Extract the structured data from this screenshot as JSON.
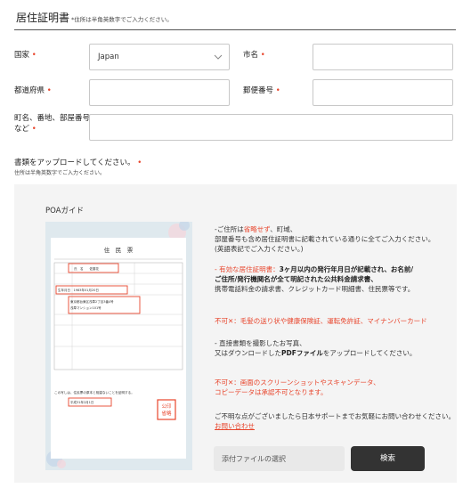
{
  "header": {
    "title": "居住証明書",
    "subtitle": "*住所は半角英数字でご入力ください。"
  },
  "form": {
    "country": {
      "label": "国家",
      "value": "Japan"
    },
    "city": {
      "label": "市名",
      "value": ""
    },
    "prefecture": {
      "label": "都道府県",
      "value": ""
    },
    "postal": {
      "label": "郵便番号",
      "value": ""
    },
    "address_line1": "町名、番地、部屋番号",
    "address_line2": "など",
    "address_value": "",
    "required_mark": "•"
  },
  "upload": {
    "label": "書類をアップロードしてください。",
    "note": "住所は半角英数字でご入力ください。"
  },
  "guide": {
    "title": "POAガイド",
    "sample": {
      "heading": "住　民　票",
      "name_row": "氏　名　　佐藤花",
      "dob_row": "生年月日　1983年01月20日",
      "addr_row": "東京都台東区浅草2丁目3番4号",
      "addr_row2": "浅草マンション101号",
      "footer": "この写しは、住民票の原本と相違ないことを証明する。",
      "date": "平成31年2月1日",
      "stamp": "公印\n省略"
    },
    "p1_a": "-ご住所は",
    "p1_b": "省略せず",
    "p1_c": "、町域、",
    "p1_line2": "部屋番号も含め居住証明書に記載されている通りに全てご入力ください。",
    "p1_line3": "(英語表記でご入力ください。)",
    "p2_a": "- 有効な居住証明書：",
    "p2_b": "3ヶ月以内の発行年月日が記載され、お名前/",
    "p2_line2": "ご住所/発行機関名が全て明記された公共料金請求書、",
    "p2_line3": "携帯電話料金の請求書、クレジットカード明細書、住民票等です。",
    "p3": "不可✕：毛髪の送り状や健康保険証、運転免許証、マイナンバーカード",
    "p4_line1": "- 直接書類を撮影したお写真、",
    "p4_line2_a": "又はダウンロードした",
    "p4_line2_b": "PDFファイル",
    "p4_line2_c": "をアップロードしてください。",
    "p5_line1": "不可✕：画面のスクリーンショットやスキャンデータ、",
    "p5_line2": "コピーデータは承認不可となります。",
    "p6": "ご不明な点がございましたら日本サポートまでお気軽にお問い合わせください。",
    "contact_link": "お問い合わせ",
    "file_placeholder": "添付ファイルの選択",
    "search_button": "検索"
  }
}
